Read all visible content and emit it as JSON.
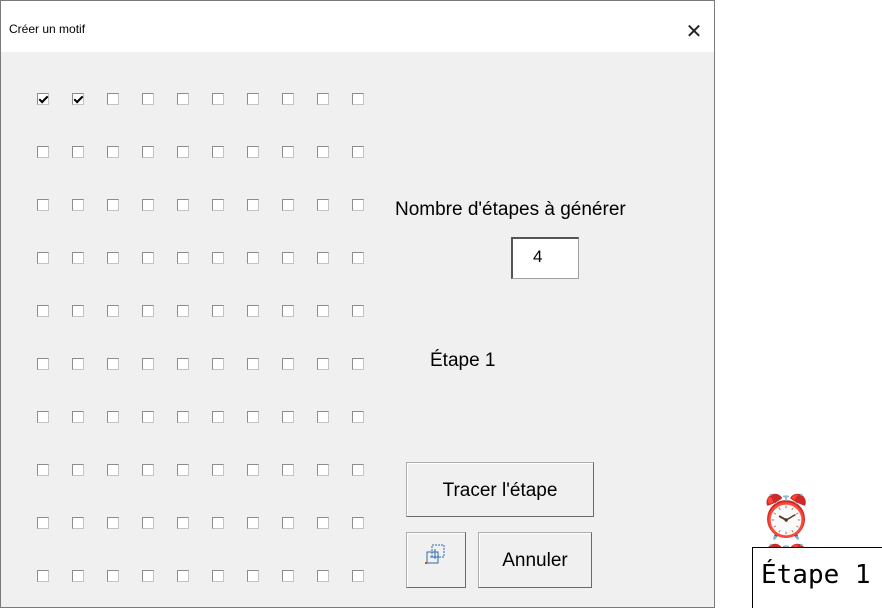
{
  "dialog": {
    "title": "Créer un motif",
    "close_glyph": "✕",
    "grid": {
      "rows": 10,
      "cols": 10,
      "checked": [
        [
          0,
          0
        ],
        [
          0,
          1
        ]
      ]
    },
    "steps_label": "Nombre d'étapes à générer",
    "steps_value": "4",
    "stage_label": "Étape 1",
    "trace_button": "Tracer l'étape",
    "cancel_button": "Annuler",
    "icon_button_icon": "copy-frame-icon"
  },
  "sheet": {
    "clock_icons": "⏰ ⏰",
    "stage_cell": "Étape 1"
  }
}
